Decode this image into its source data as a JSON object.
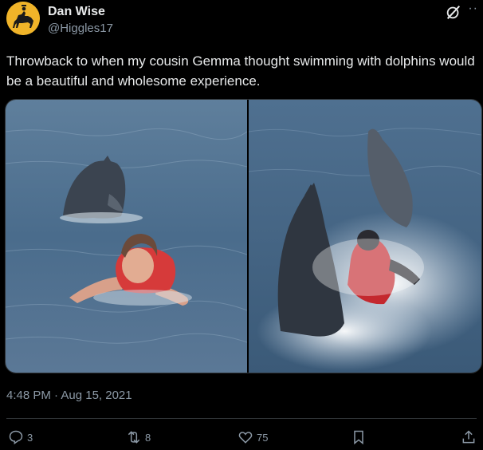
{
  "author": {
    "name": "Dan Wise",
    "handle": "@Higgles17",
    "avatar_color": "#f0b429"
  },
  "header_icons": {
    "grok": "grok-icon",
    "more": "more-icon",
    "more_label": "··"
  },
  "tweet": {
    "text": "Throwback to when my cousin Gemma thought swimming with dolphins would be a beautiful and wholesome experience.",
    "timestamp": "4:48 PM · Aug 15, 2021"
  },
  "media": [
    {
      "name": "photo-calm-swim",
      "description_icon": "photo"
    },
    {
      "name": "photo-dolphin-attack",
      "description_icon": "photo"
    }
  ],
  "actions": {
    "reply_count": "3",
    "retweet_count": "8",
    "like_count": "75"
  },
  "colors": {
    "background": "#000000",
    "text_primary": "#e7e9ea",
    "text_secondary": "#8b98a5",
    "divider": "#2f3336"
  }
}
